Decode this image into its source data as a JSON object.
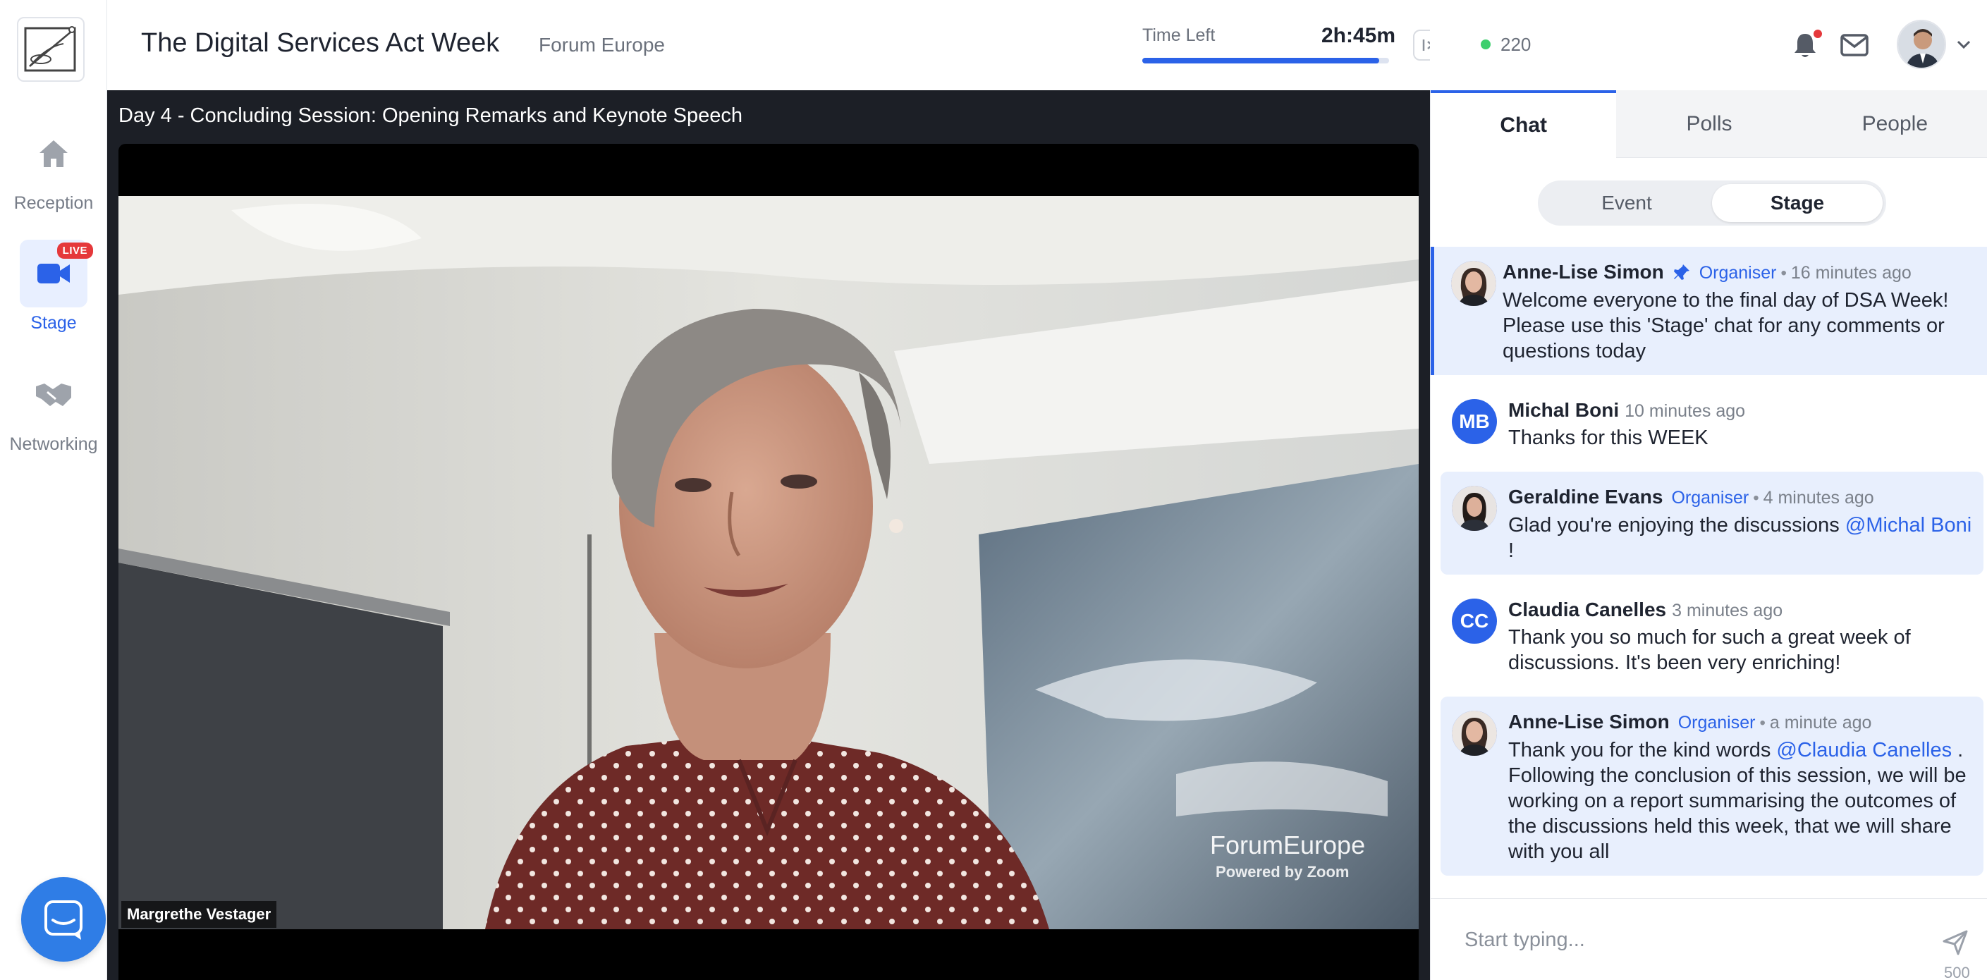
{
  "rail": {
    "items": [
      {
        "label": "Reception",
        "icon": "home-icon"
      },
      {
        "label": "Stage",
        "icon": "video-camera-icon",
        "badge": "LIVE",
        "active": true
      },
      {
        "label": "Networking",
        "icon": "handshake-icon"
      }
    ]
  },
  "header": {
    "event_title": "The Digital Services Act Week",
    "organizer": "Forum Europe",
    "time_left_label": "Time Left",
    "time_left_value": "2h:45m",
    "time_left_progress_percent": 96,
    "online_count": "220"
  },
  "stage": {
    "session_title": "Day 4 - Concluding Session: Opening Remarks and Keynote Speech",
    "speaker_name": "Margrethe Vestager",
    "watermark_brand": "ForumEurope",
    "watermark_powered": "Powered by Zoom"
  },
  "panel": {
    "tabs": [
      "Chat",
      "Polls",
      "People"
    ],
    "active_tab": "Chat",
    "segments": [
      "Event",
      "Stage"
    ],
    "active_segment": "Stage",
    "messages": [
      {
        "author": "Anne-Lise Simon",
        "role": "Organiser",
        "time": "16 minutes ago",
        "pinned": true,
        "text": "Welcome everyone to the final day of DSA Week! Please use this 'Stage' chat for any comments or questions today"
      },
      {
        "author": "Michal Boni",
        "initials": "MB",
        "time": "10 minutes ago",
        "text": "Thanks for this WEEK"
      },
      {
        "author": "Geraldine Evans",
        "role": "Organiser",
        "time": "4 minutes ago",
        "text_before": "Glad you're enjoying the discussions ",
        "mention": "@Michal Boni",
        "text_after": " !"
      },
      {
        "author": "Claudia Canelles",
        "initials": "CC",
        "time": "3 minutes ago",
        "text": "Thank you so much for such a great week of discussions. It's been very enriching!"
      },
      {
        "author": "Anne-Lise Simon",
        "role": "Organiser",
        "time": "a minute ago",
        "text_before": "Thank you for the kind words ",
        "mention": "@Claudia Canelles",
        "text_after": " . Following the conclusion of this session, we will be working on a report summarising the outcomes of the discussions held this week, that we will share with you all"
      }
    ],
    "composer_placeholder": "Start typing...",
    "char_limit": "500"
  },
  "colors": {
    "accent": "#2b62e8",
    "live_badge": "#e5383b",
    "online": "#3ecf6e",
    "highlight_bg": "#e8effd"
  }
}
